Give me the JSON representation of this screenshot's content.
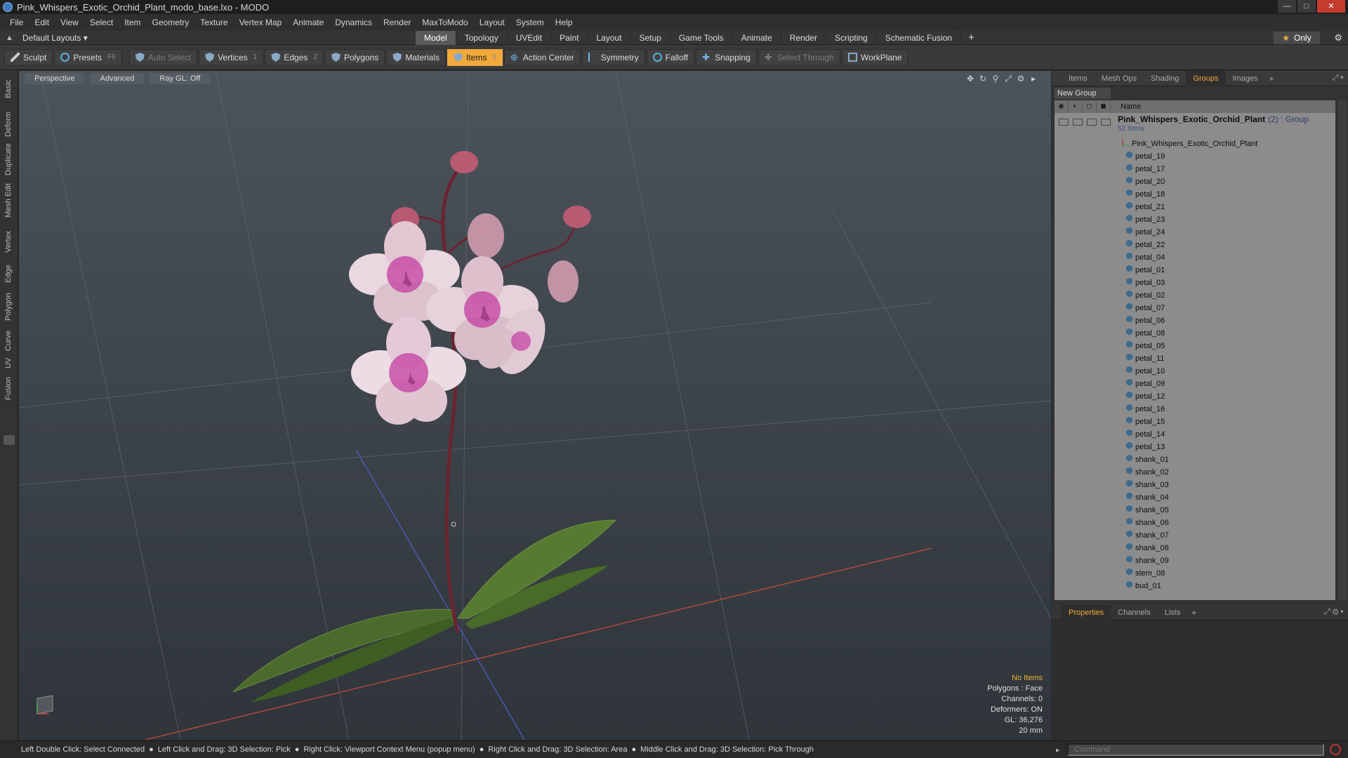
{
  "window": {
    "title": "Pink_Whispers_Exotic_Orchid_Plant_modo_base.lxo - MODO"
  },
  "menu": [
    "File",
    "Edit",
    "View",
    "Select",
    "Item",
    "Geometry",
    "Texture",
    "Vertex Map",
    "Animate",
    "Dynamics",
    "Render",
    "MaxToModo",
    "Layout",
    "System",
    "Help"
  ],
  "layoutbar": {
    "layout_select": "Default Layouts",
    "tabs": [
      "Model",
      "Topology",
      "UVEdit",
      "Paint",
      "Layout",
      "Setup",
      "Game Tools",
      "Animate",
      "Render",
      "Scripting",
      "Schematic Fusion"
    ],
    "active_tab": "Model",
    "add_label": "+",
    "only_label": "Only"
  },
  "toolbar": {
    "sculpt": "Sculpt",
    "presets": "Presets",
    "presets_key": "F6",
    "auto_select": "Auto Select",
    "vertices": "Vertices",
    "vertices_key": "1",
    "edges": "Edges",
    "edges_key": "2",
    "polygons": "Polygons",
    "materials": "Materials",
    "items": "Items",
    "items_key": "5",
    "action_center": "Action Center",
    "symmetry": "Symmetry",
    "falloff": "Falloff",
    "snapping": "Snapping",
    "select_through": "Select Through",
    "workplane": "WorkPlane"
  },
  "left_tabs": [
    "Basic",
    "Deform",
    "Duplicate",
    "Mesh Edit",
    "Vertex",
    "Edge",
    "Polygon",
    "Curve",
    "UV",
    "Fusion"
  ],
  "viewport": {
    "perspective": "Perspective",
    "advanced": "Advanced",
    "raygl": "Ray GL: Off",
    "stats": {
      "items": "No Items",
      "polygons": "Polygons : Face",
      "channels": "Channels: 0",
      "deformers": "Deformers: ON",
      "gl": "GL: 36,276",
      "scale": "20 mm"
    }
  },
  "right_panel": {
    "tabs": [
      "Items",
      "Mesh Ops",
      "Shading",
      "Groups",
      "Images"
    ],
    "active_tab": "Groups",
    "add_label": "+",
    "new_group": "New Group",
    "header_name": "Name",
    "root": {
      "name": "Pink_Whispers_Exotic_Orchid_Plant",
      "meta": "(2) : Group",
      "sub": "52 Items"
    },
    "mesh_item": "Pink_Whispers_Exotic_Orchid_Plant",
    "items": [
      "petal_19",
      "petal_17",
      "petal_20",
      "petal_18",
      "petal_21",
      "petal_23",
      "petal_24",
      "petal_22",
      "petal_04",
      "petal_01",
      "petal_03",
      "petal_02",
      "petal_07",
      "petal_06",
      "petal_08",
      "petal_05",
      "petal_11",
      "petal_10",
      "petal_09",
      "petal_12",
      "petal_16",
      "petal_15",
      "petal_14",
      "petal_13",
      "shank_01",
      "shank_02",
      "shank_03",
      "shank_04",
      "shank_05",
      "shank_06",
      "shank_07",
      "shank_08",
      "shank_09",
      "stem_08",
      "bud_01"
    ],
    "bottom_tabs": [
      "Properties",
      "Channels",
      "Lists"
    ],
    "bottom_active": "Properties"
  },
  "statusbar": {
    "hints": [
      "Left Double Click: Select Connected",
      "Left Click and Drag: 3D Selection: Pick",
      "Right Click: Viewport Context Menu (popup menu)",
      "Right Click and Drag: 3D Selection: Area",
      "Middle Click and Drag: 3D Selection: Pick Through"
    ],
    "command_placeholder": "Command"
  },
  "colors": {
    "accent": "#f1a93b",
    "viewport_top": "#4c545b",
    "tree_bg": "#8c8c8c"
  }
}
